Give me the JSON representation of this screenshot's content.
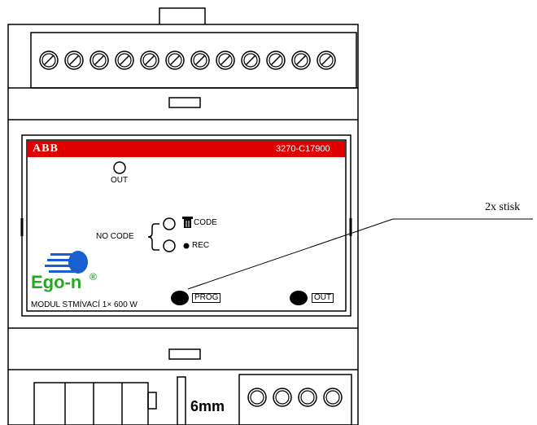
{
  "device": {
    "brand": "ABB",
    "model_code": "3270-C17900",
    "out_led_label": "OUT",
    "no_code_label": "NO CODE",
    "code_label": "CODE",
    "rec_label": "REC",
    "logo_text": "Ego-n",
    "logo_mark": "®",
    "module_label": "MODUL STMÍVACÍ 1× 600 W",
    "prog_button_label": "PROG",
    "out_button_label": "OUT",
    "width_note": "6mm",
    "top_terminal_count": 12,
    "bottom_terminal_count": 4
  },
  "annotation": {
    "text": "2x stisk"
  },
  "colors": {
    "brand_bar": "#e00000",
    "logo_green": "#22aa22",
    "logo_blue": "#1a5fd0",
    "outline": "#000000"
  }
}
